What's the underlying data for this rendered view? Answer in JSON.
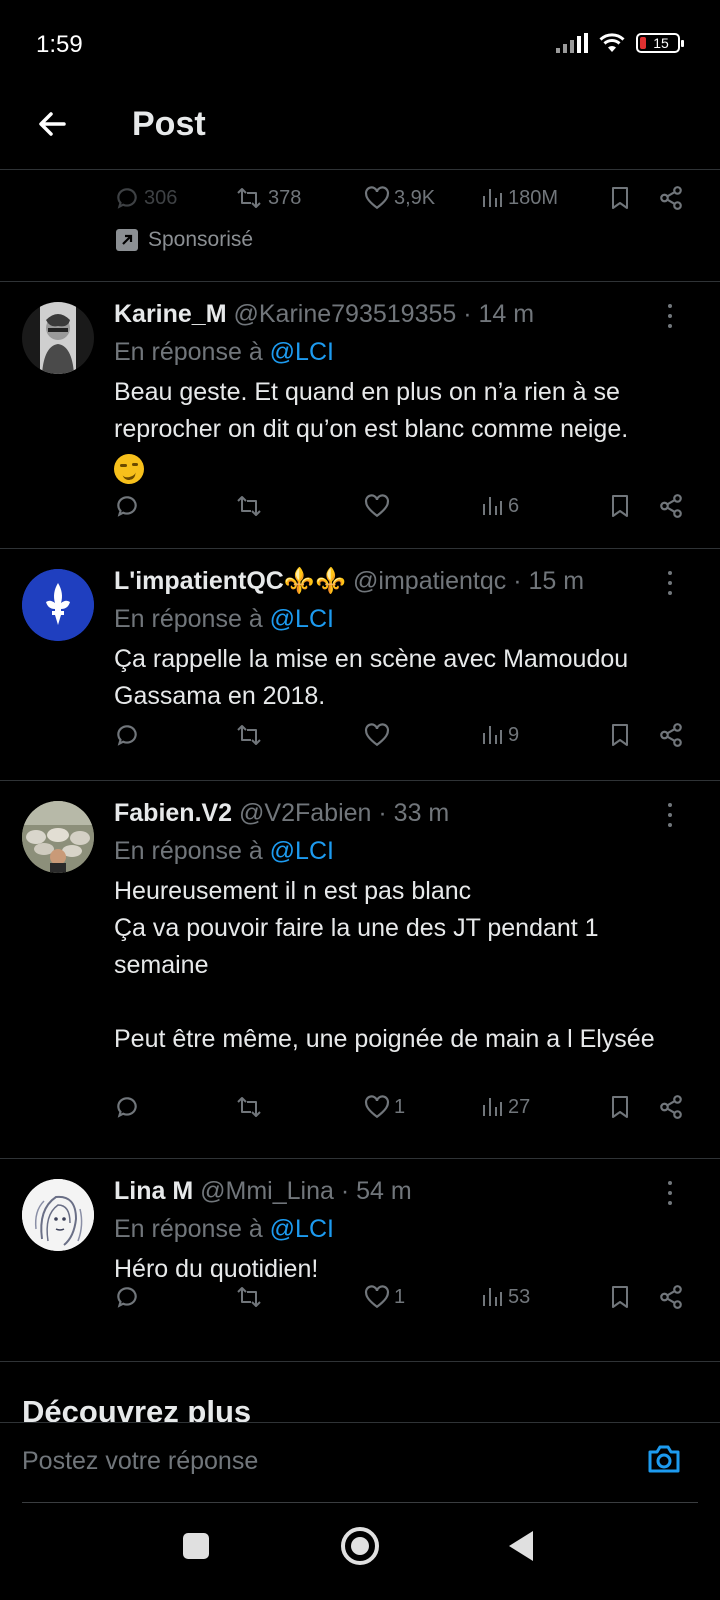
{
  "status_bar": {
    "time": "1:59",
    "battery": "15"
  },
  "header": {
    "title": "Post"
  },
  "top_stats": {
    "replies": "306",
    "reposts": "378",
    "likes": "3,9K",
    "views": "180M",
    "sponsored_label": "Sponsorisé"
  },
  "reply_prefix": "En réponse à",
  "tweets": [
    {
      "name": "Karine_M",
      "handle": "@Karine793519355",
      "time": "· 14 m",
      "reply_to": "@LCI",
      "text": "Beau geste. Et quand en plus on n’a rien à se reprocher on dit qu’on est blanc comme neige.",
      "emoji": "smirking-face",
      "replies": "",
      "reposts": "",
      "likes": "",
      "views": "6"
    },
    {
      "name": "L'impatientQC⚜️⚜️",
      "handle": "@impatientqc",
      "time": "· 15 m",
      "reply_to": "@LCI",
      "text": "Ça rappelle la mise en scène avec Mamoudou Gassama en 2018.",
      "replies": "",
      "reposts": "",
      "likes": "",
      "views": "9"
    },
    {
      "name": "Fabien.V2",
      "handle": "@V2Fabien",
      "time": "· 33 m",
      "reply_to": "@LCI",
      "text": "Heureusement il n est pas blanc\nÇa va pouvoir faire la une des JT pendant 1 semaine\n\nPeut être même, une poignée de main a l Elysée",
      "replies": "",
      "reposts": "",
      "likes": "1",
      "views": "27"
    },
    {
      "name": "Lina M",
      "handle": "@Mmi_Lina",
      "time": "· 54 m",
      "reply_to": "@LCI",
      "text": "Héro du quotidien!",
      "replies": "",
      "reposts": "",
      "likes": "1",
      "views": "53"
    }
  ],
  "discover": {
    "title": "Découvrez plus"
  },
  "reply_bar": {
    "placeholder": "Postez votre réponse"
  },
  "colors": {
    "accent": "#1d9bf0",
    "muted": "#71767b",
    "text": "#e7e9ea",
    "background": "#000000",
    "divider": "#2f3336"
  }
}
